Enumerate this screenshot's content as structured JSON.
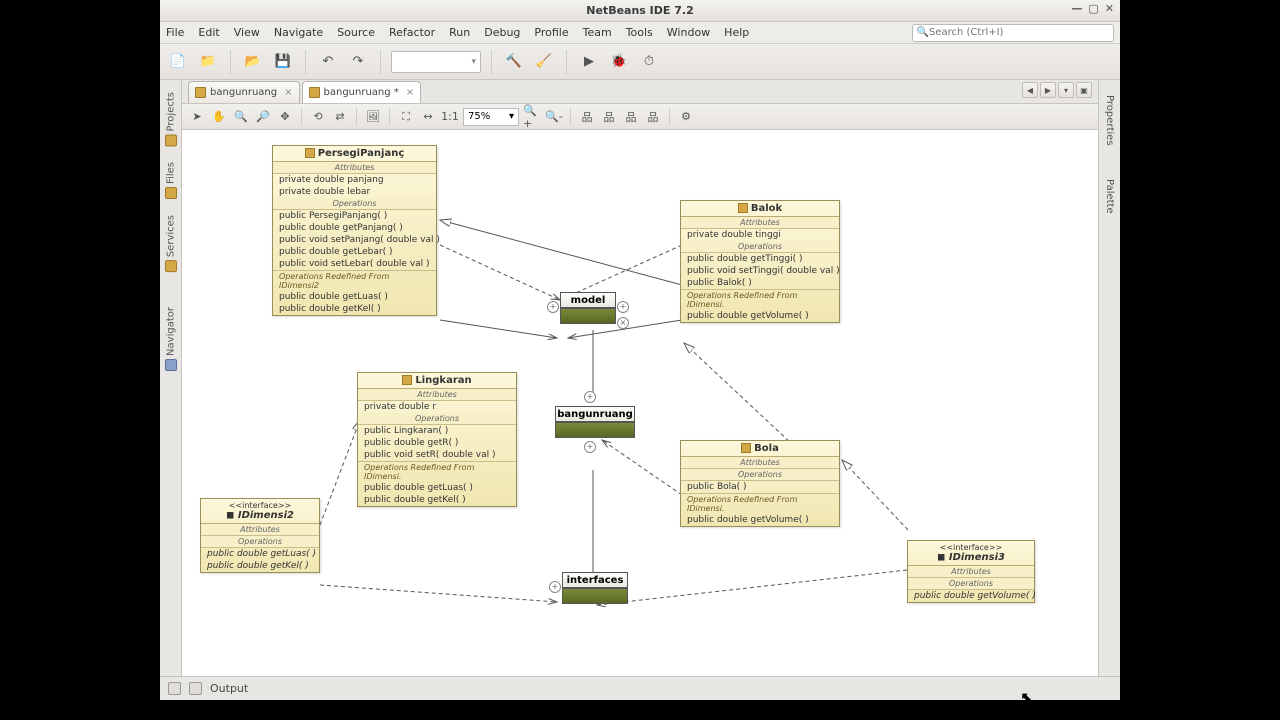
{
  "window": {
    "title": "NetBeans IDE 7.2"
  },
  "menu": [
    "File",
    "Edit",
    "View",
    "Navigate",
    "Source",
    "Refactor",
    "Run",
    "Debug",
    "Profile",
    "Team",
    "Tools",
    "Window",
    "Help"
  ],
  "search": {
    "placeholder": "Search (Ctrl+I)"
  },
  "tabs": [
    {
      "label": "bangunruang",
      "modified": false
    },
    {
      "label": "bangunruang",
      "modified": true
    }
  ],
  "zoom": "75%",
  "left_panels": [
    "Projects",
    "Files",
    "Services",
    "Navigator"
  ],
  "right_panels": [
    "Properties",
    "Palette"
  ],
  "statusbar": {
    "output": "Output"
  },
  "packages": {
    "model": {
      "label": "model"
    },
    "bangunruang": {
      "label": "bangunruang"
    },
    "interfaces": {
      "label": "interfaces"
    }
  },
  "classes": {
    "PersegiPanjang": {
      "name": "PersegiPanjanç",
      "section_attr": "Attributes",
      "attrs": [
        "private double panjang",
        "private double lebar"
      ],
      "section_op": "Operations",
      "ops": [
        "public PersegiPanjang( )",
        "public double  getPanjang( )",
        "public void  setPanjang( double val )",
        "public double  getLebar( )",
        "public void  setLebar( double val )"
      ],
      "redef_h": "Operations Redefined From IDimensi2",
      "redef_ops": [
        "public double  getLuas( )",
        "public double  getKel( )"
      ]
    },
    "Balok": {
      "name": "Balok",
      "section_attr": "Attributes",
      "attrs": [
        "private double tinggi"
      ],
      "section_op": "Operations",
      "ops": [
        "public double  getTinggi( )",
        "public void  setTinggi( double val )",
        "public Balok( )"
      ],
      "redef_h": "Operations Redefined From IDimensi.",
      "redef_ops": [
        "public double  getVolume( )"
      ]
    },
    "Lingkaran": {
      "name": "Lingkaran",
      "section_attr": "Attributes",
      "attrs": [
        "private double r"
      ],
      "section_op": "Operations",
      "ops": [
        "public Lingkaran( )",
        "public double  getR( )",
        "public void  setR( double val )"
      ],
      "redef_h": "Operations Redefined From IDimensi.",
      "redef_ops": [
        "public double  getLuas( )",
        "public double  getKel( )"
      ]
    },
    "Bola": {
      "name": "Bola",
      "section_attr": "Attributes",
      "attrs": [],
      "section_op": "Operations",
      "ops": [
        "public Bola( )"
      ],
      "redef_h": "Operations Redefined From IDimensi.",
      "redef_ops": [
        "public double  getVolume( )"
      ]
    },
    "IDimensi2": {
      "stereo": "<<interface>>",
      "name": "IDimensi2",
      "section_attr": "Attributes",
      "section_op": "Operations",
      "ops": [
        "public double  getLuas( )",
        "public double  getKel( )"
      ]
    },
    "IDimensi3": {
      "stereo": "<<interface>>",
      "name": "IDimensi3",
      "section_attr": "Attributes",
      "section_op": "Operations",
      "ops": [
        "public double  getVolume( )"
      ]
    }
  }
}
